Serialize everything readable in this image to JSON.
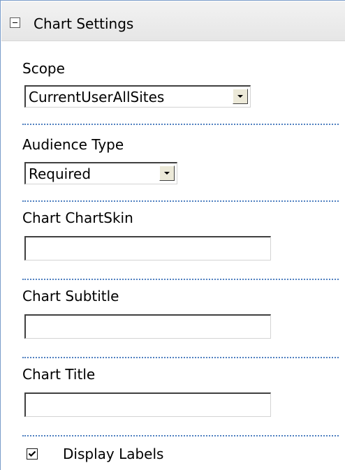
{
  "panel": {
    "title": "Chart Settings",
    "collapse_icon": "minus-box-icon"
  },
  "fields": {
    "scope": {
      "label": "Scope",
      "selected": "CurrentUserAllSites"
    },
    "audience_type": {
      "label": "Audience Type",
      "selected": "Required"
    },
    "chart_skin": {
      "label": "Chart ChartSkin",
      "value": ""
    },
    "chart_subtitle": {
      "label": "Chart Subtitle",
      "value": ""
    },
    "chart_title": {
      "label": "Chart Title",
      "value": ""
    },
    "display_labels": {
      "label": "Display Labels",
      "checked": true
    }
  },
  "colors": {
    "divider": "#4f80c0",
    "header_bg": "#efefef",
    "frame_border": "#7a9cc9"
  }
}
